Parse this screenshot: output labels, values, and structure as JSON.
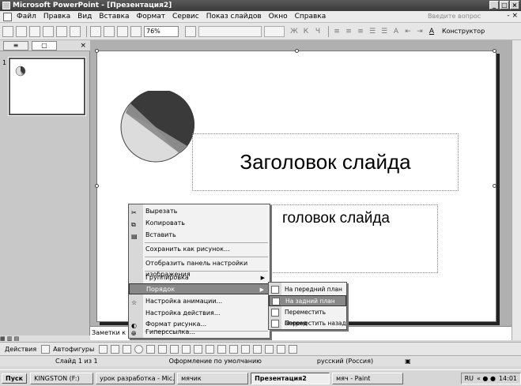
{
  "window": {
    "title": "Microsoft PowerPoint - [Презентация2]"
  },
  "menu": {
    "items": [
      "Файл",
      "Правка",
      "Вид",
      "Вставка",
      "Формат",
      "Сервис",
      "Показ слайдов",
      "Окно",
      "Справка"
    ],
    "help_placeholder": "Введите вопрос"
  },
  "toolbar": {
    "zoom": "76%",
    "designer_label": "Конструктор"
  },
  "slide": {
    "number": "1",
    "title": "Заголовок слайда",
    "subtitle_fragment": "голов​ок слайда"
  },
  "notes": {
    "placeholder": "Заметки к слайду"
  },
  "context_menu": {
    "items": [
      "Вырезать",
      "Копировать",
      "Вставить",
      "Сохранить как рисунок...",
      "Отобразить панель настройки изображения",
      "Группировка",
      "Порядок",
      "Настройка анимации...",
      "Настройка действия...",
      "Формат рисунка...",
      "Гиперссылка..."
    ],
    "highlighted": "Порядок"
  },
  "submenu": {
    "items": [
      "На передний план",
      "На задний план",
      "Переместить вперед",
      "Переместить назад"
    ],
    "highlighted": "На задний план"
  },
  "drawbar": {
    "actions_label": "Действия",
    "autoshapes_label": "Автофигуры"
  },
  "status": {
    "slide_info": "Слайд 1 из 1",
    "design": "Оформление по умолчанию",
    "language": "русский (Россия)"
  },
  "taskbar": {
    "start": "Пуск",
    "buttons": [
      "KINGSTON (F:)",
      "урок разработка - Mic...",
      "мячик",
      "Презентация2",
      "мяч - Paint"
    ],
    "active": "Презентация2",
    "lang": "RU",
    "time": "14:01"
  },
  "colors": {
    "pie_dark": "#3a3a3a",
    "pie_mid": "#8a8a8a",
    "pie_light": "#dcdcdc"
  }
}
